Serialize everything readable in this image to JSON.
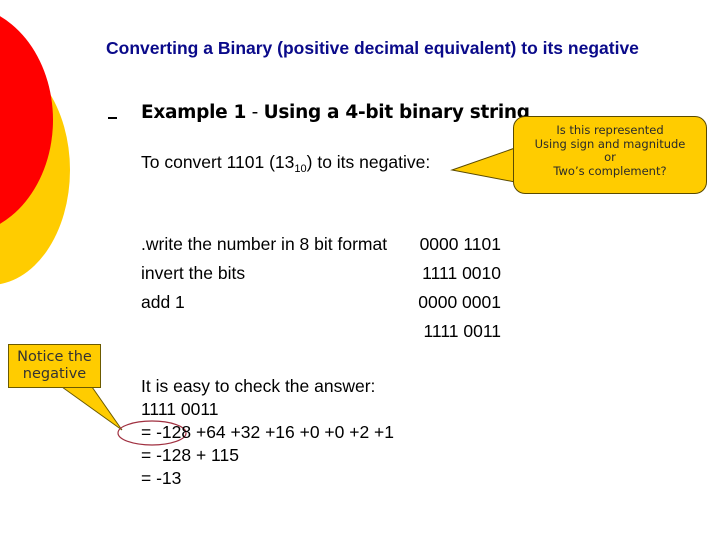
{
  "slide": {
    "title": "Converting a Binary (positive decimal equivalent) to its negative",
    "bullet_marker": "–",
    "example_heading": {
      "bold_part_1": "Example 1",
      "separator": " - ",
      "bold_part_2": "Using a 4-bit binary string"
    },
    "convert_line": {
      "prefix": "To convert 1101 (13",
      "subscript": "10",
      "suffix": ") to its negative:"
    },
    "callout_top": {
      "lines": [
        "Is this represented",
        "Using sign and magnitude",
        "or",
        "Two’s complement?"
      ]
    },
    "steps": [
      {
        "label": ".write the number in 8 bit format",
        "value": "0000 1101"
      },
      {
        "label": "invert the bits",
        "value": "1111 0010"
      },
      {
        "label": "add 1",
        "value": "0000 0001"
      },
      {
        "label": "",
        "value": "1111 0011"
      }
    ],
    "callout_left": {
      "lines": [
        "Notice the",
        "negative"
      ]
    },
    "check": {
      "lines": [
        "It is easy to check the answer:",
        "1111 0011",
        "= -128 +64 +32 +16 +0 +0 +2 +1",
        "= -128 + 115",
        "= -13"
      ]
    },
    "colors": {
      "title": "#0a0a8a",
      "red_circle": "#ff0000",
      "yellow_circle": "#ffcc00",
      "callout_fill": "#ffcc00",
      "highlight_ellipse": "#a03040"
    }
  }
}
